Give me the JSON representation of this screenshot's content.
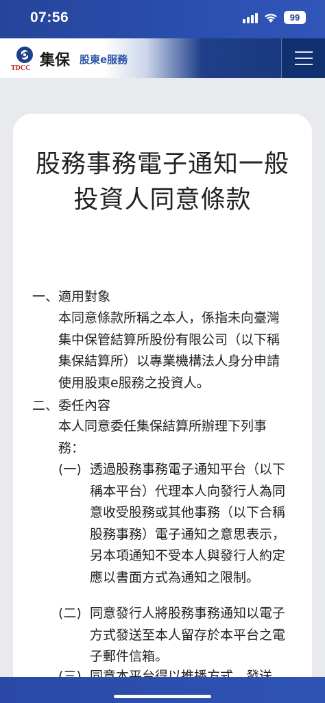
{
  "status_bar": {
    "time": "07:56",
    "battery": "99",
    "icons": [
      "signal-icon",
      "wifi-icon",
      "battery-icon"
    ]
  },
  "header": {
    "logo_text": "TDCC",
    "logo_chinese": "集保",
    "service_name": "股東e服務",
    "menu_icon": "hamburger-menu-icon"
  },
  "document": {
    "title": "股務事務電子通知一般投資人同意條款",
    "sections": [
      {
        "heading": "一、適用對象",
        "paragraph": "本同意條款所稱之本人，係指未向臺灣集中保管結算所股份有限公司（以下稱集保結算所）以專業機構法人身分申請使用股東e服務之投資人。"
      },
      {
        "heading": "二、委任內容",
        "paragraph": "本人同意委任集保結算所辦理下列事務：",
        "items": [
          {
            "marker": "(一)",
            "text": "透過股務事務電子通知平台（以下稱本平台）代理本人向發行人為同意收受股務或其他事務（以下合稱股務事務）電子通知之意思表示，另本項通知不受本人與發行人約定應以書面方式為通知之限制。"
          },
          {
            "marker": "(二)",
            "text": "同意發行人將股務事務通知以電子方式發送至本人留存於本平台之電子郵件信箱。"
          },
          {
            "marker": "(三)",
            "text": "同意本平台得以推播方式，發送"
          }
        ]
      }
    ]
  }
}
